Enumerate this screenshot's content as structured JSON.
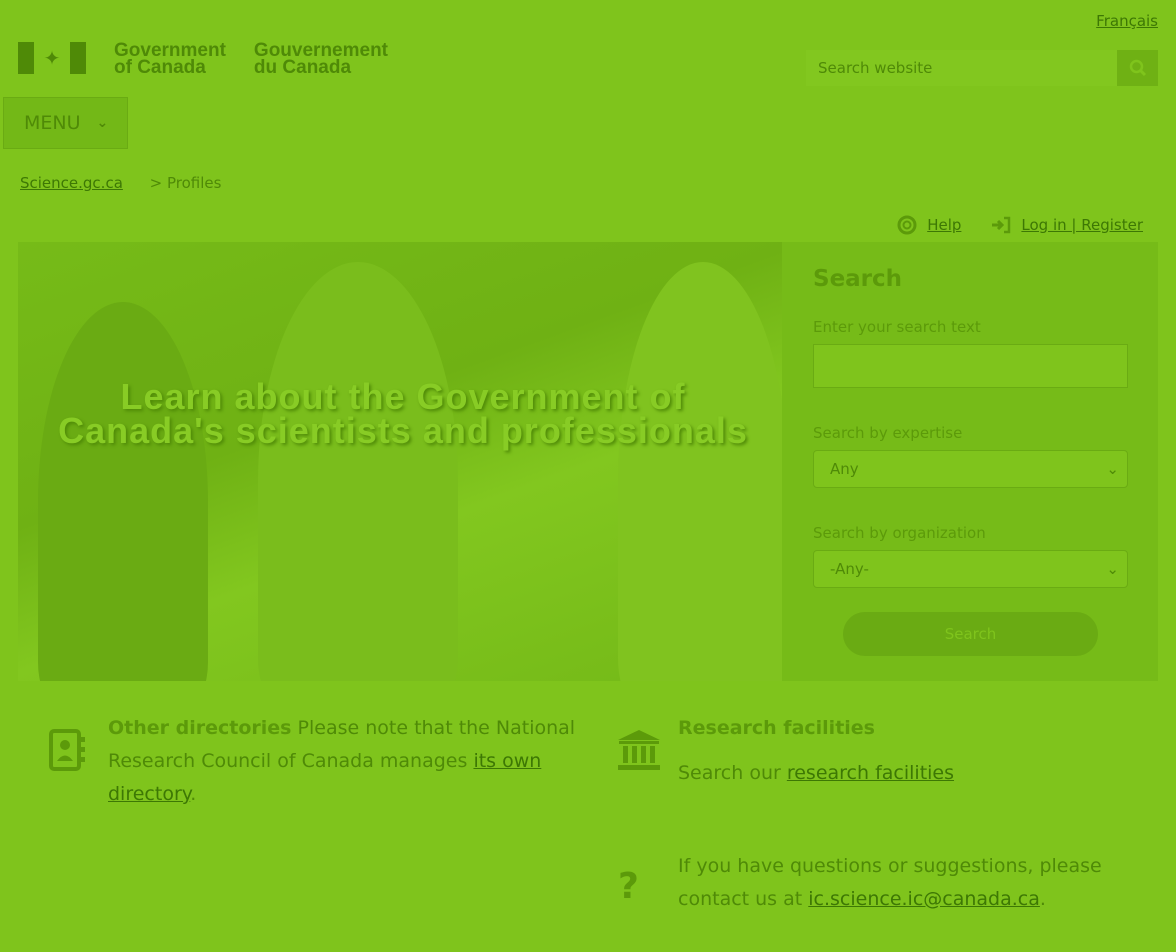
{
  "header": {
    "language_link": "Français",
    "logo_en_line1": "Government",
    "logo_en_line2": "of Canada",
    "logo_fr_line1": "Gouvernement",
    "logo_fr_line2": "du Canada",
    "search_placeholder": "Search website",
    "menu_label": "MENU"
  },
  "breadcrumb": {
    "home": "Science.gc.ca",
    "current": "> Profiles"
  },
  "utility": {
    "help": "Help",
    "login": "Log in | Register"
  },
  "hero": {
    "title": "Learn about the Government of Canada's  scientists and professionals",
    "form_title": "Search",
    "text_label": "Enter your search text",
    "expertise_label": "Search by expertise",
    "expertise_value": "Any",
    "org_label": "Search by organization",
    "org_value": "-Any-",
    "button": "Search"
  },
  "info": {
    "dir_title": "Other directories",
    "dir_text": " Please note that the National Research Council of Canada manages ",
    "dir_link": "its own directory",
    "dir_end": ".",
    "fac_title": "Research facilities",
    "fac_text": "Search our ",
    "fac_link": "research facilities",
    "contact_text": "If you have questions or suggestions, please contact us at ",
    "contact_link": "ic.science.ic@canada.ca",
    "contact_end": "."
  },
  "icons": [
    "address-book-icon",
    "institution-icon",
    "question-icon",
    "life-ring-icon",
    "sign-in-icon",
    "search-icon",
    "chevron-down-icon"
  ]
}
